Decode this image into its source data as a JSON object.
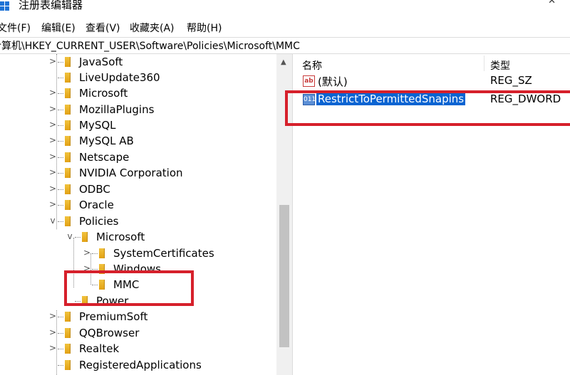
{
  "window": {
    "title": "注册表编辑器"
  },
  "menu": [
    "文件(F)",
    "编辑(E)",
    "查看(V)",
    "收藏夹(A)",
    "帮助(H)"
  ],
  "address": {
    "path": "计算机\\HKEY_CURRENT_USER\\Software\\Policies\\Microsoft\\MMC"
  },
  "tree": {
    "items": [
      {
        "label": "JavaSoft",
        "chevron": ">"
      },
      {
        "label": "LiveUpdate360",
        "chevron": ""
      },
      {
        "label": "Microsoft",
        "chevron": ">"
      },
      {
        "label": "MozillaPlugins",
        "chevron": ">"
      },
      {
        "label": "MySQL",
        "chevron": ">"
      },
      {
        "label": "MySQL AB",
        "chevron": ">"
      },
      {
        "label": "Netscape",
        "chevron": ">"
      },
      {
        "label": "NVIDIA Corporation",
        "chevron": ">"
      },
      {
        "label": "ODBC",
        "chevron": ">"
      },
      {
        "label": "Oracle",
        "chevron": ">"
      },
      {
        "label": "Policies",
        "chevron": "v"
      },
      {
        "label": "Microsoft",
        "chevron": "v"
      },
      {
        "label": "SystemCertificates",
        "chevron": ">"
      },
      {
        "label": "Windows",
        "chevron": ">"
      },
      {
        "label": "MMC",
        "chevron": ""
      },
      {
        "label": "Power",
        "chevron": ""
      },
      {
        "label": "PremiumSoft",
        "chevron": ">"
      },
      {
        "label": "QQBrowser",
        "chevron": ">"
      },
      {
        "label": "Realtek",
        "chevron": ">"
      },
      {
        "label": "RegisteredApplications",
        "chevron": ""
      }
    ]
  },
  "list": {
    "columns": {
      "name": "名称",
      "type": "类型"
    },
    "rows": [
      {
        "name": "(默认)",
        "type": "REG_SZ",
        "icon": "string-value-icon"
      },
      {
        "name": "RestrictToPermittedSnapins",
        "type": "REG_DWORD",
        "icon": "binary-value-icon"
      }
    ]
  },
  "colors": {
    "selection": "#0a64d2",
    "highlight": "#d6202b",
    "folder": "#f1c23d"
  }
}
